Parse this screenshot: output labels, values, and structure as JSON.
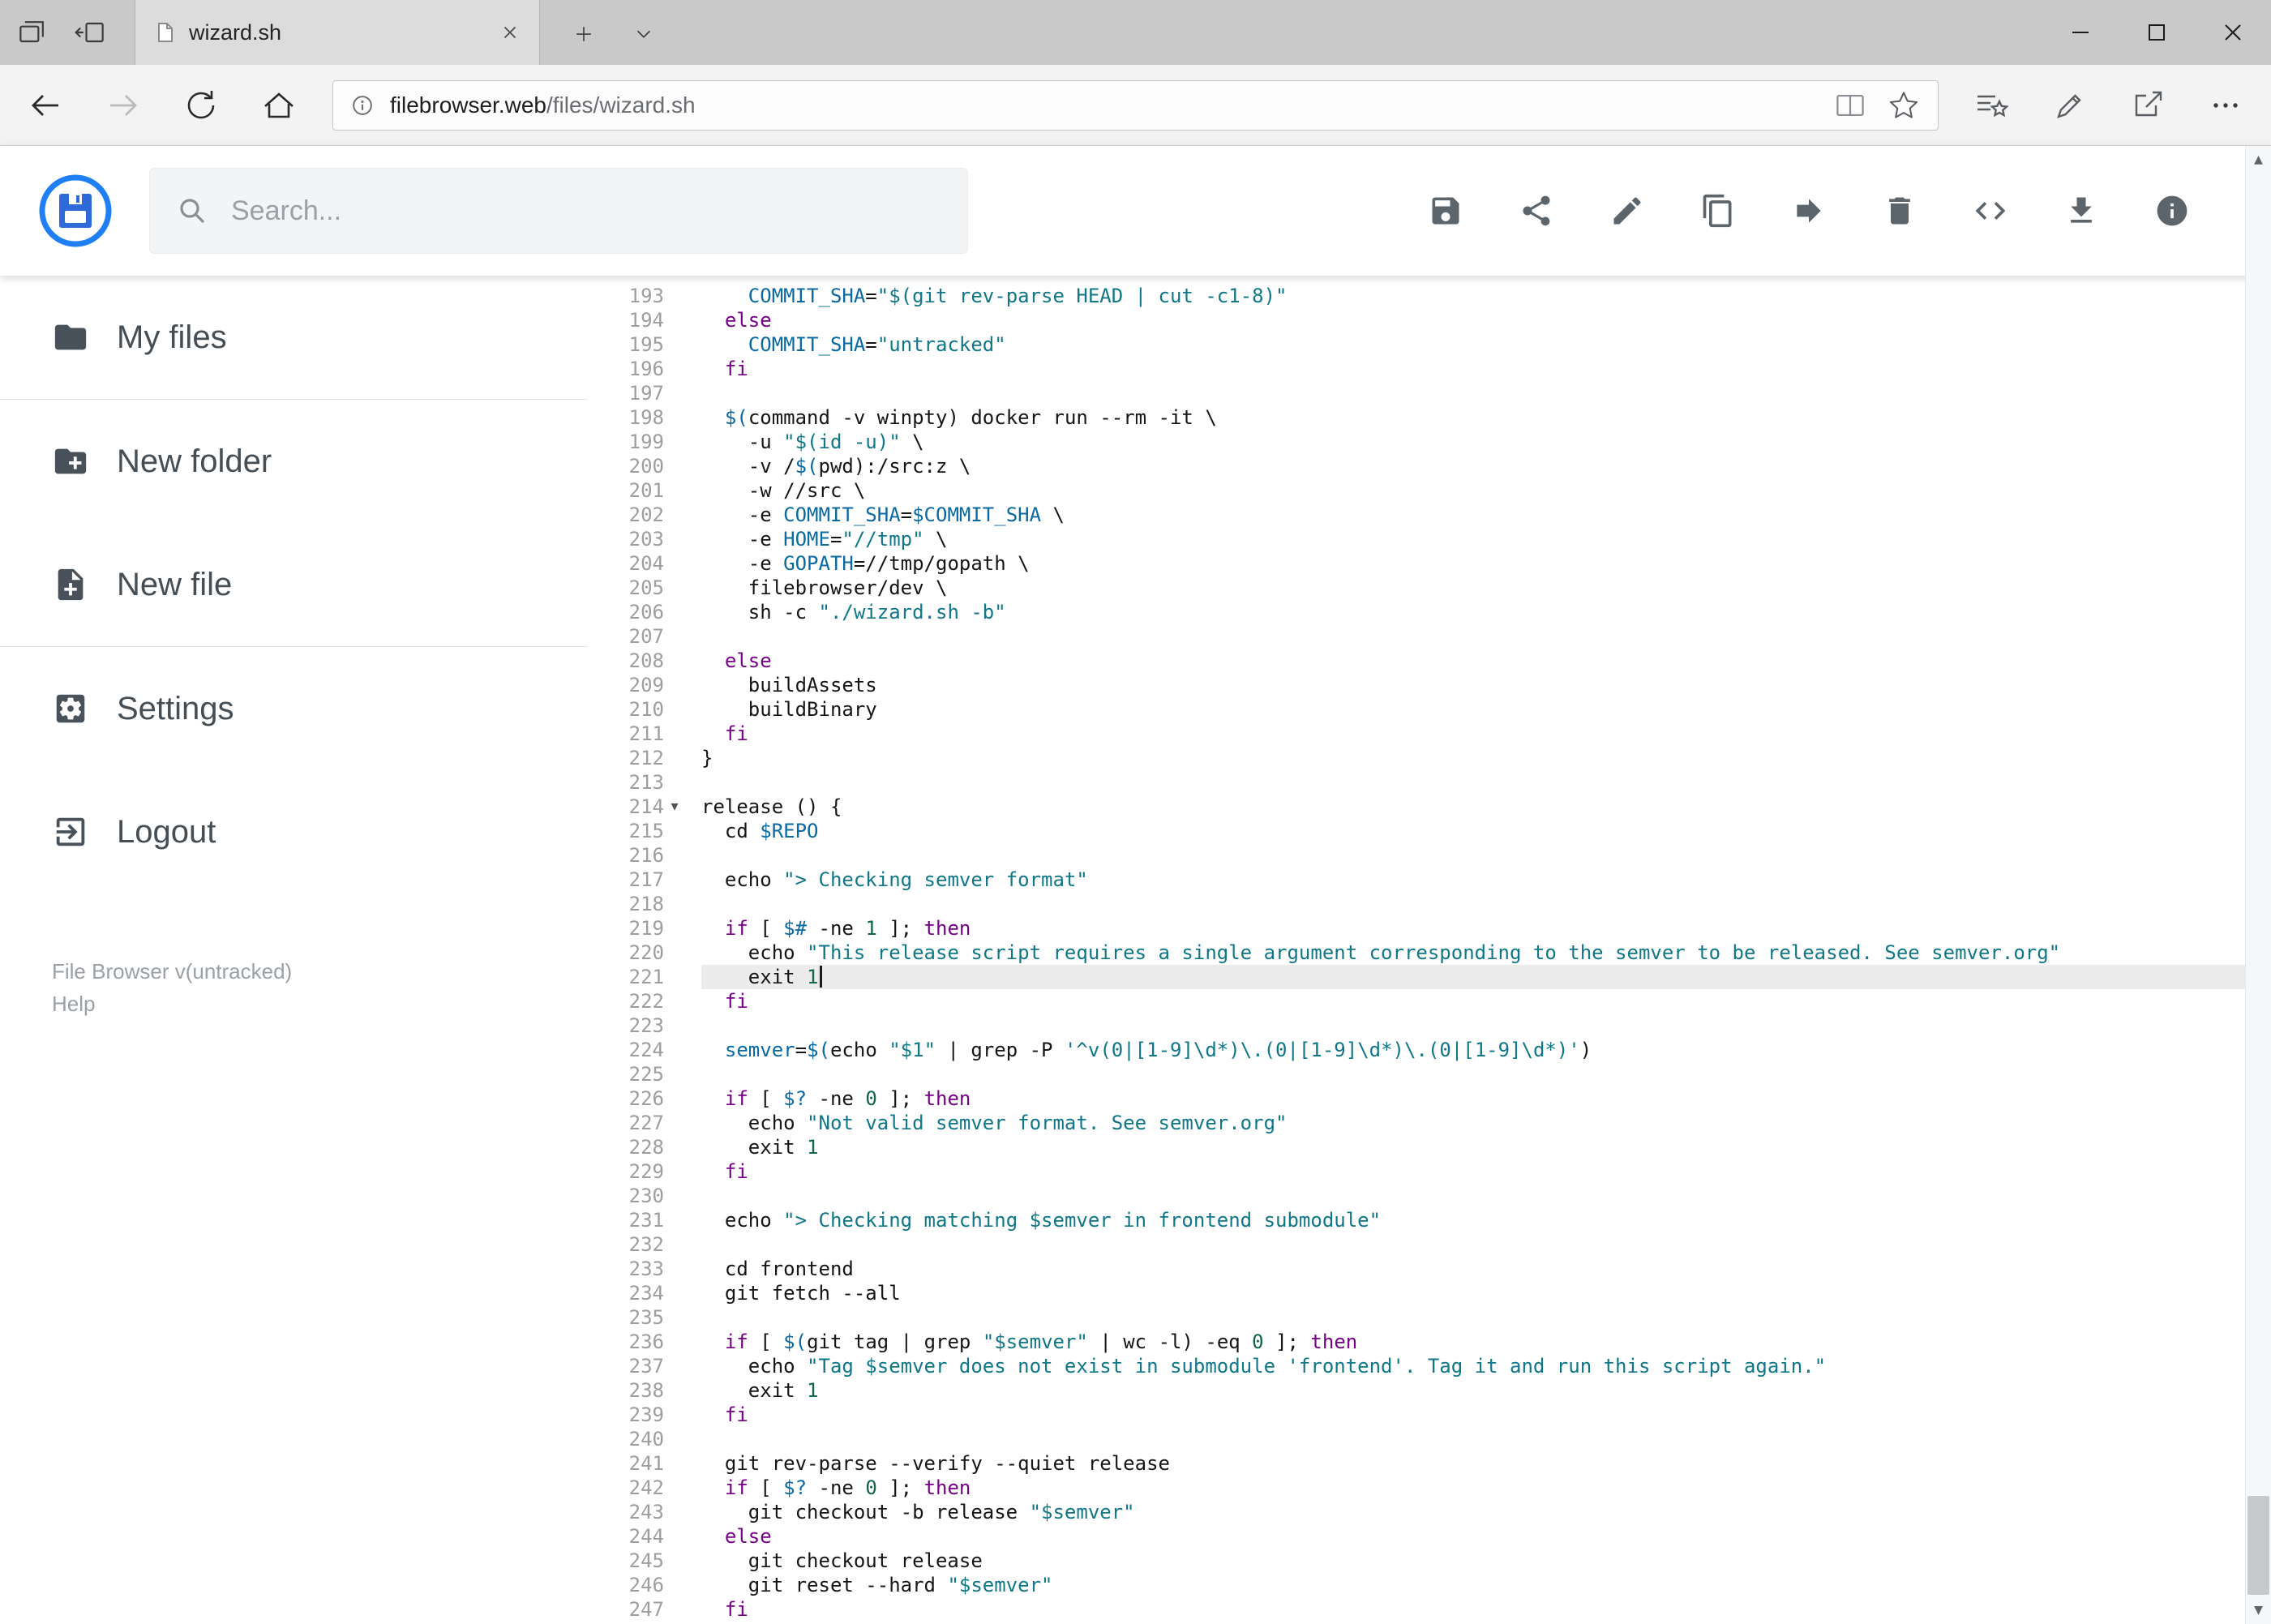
{
  "colors": {
    "accent_blue": "#1f7ff5",
    "keyword": "#770088",
    "string": "#0f7787",
    "variable": "#0969a2",
    "number": "#116644",
    "active_line_bg": "#ececec"
  },
  "browser": {
    "tab_title": "wizard.sh",
    "url_domain": "filebrowser.web",
    "url_path": "/files/wizard.sh"
  },
  "app": {
    "search_placeholder": "Search...",
    "toolbar_icons": [
      "save",
      "share",
      "edit",
      "copy",
      "move",
      "delete",
      "code",
      "download",
      "info"
    ]
  },
  "sidebar": {
    "items": [
      {
        "label": "My files",
        "icon": "folder-icon"
      },
      {
        "label": "New folder",
        "icon": "new-folder-icon"
      },
      {
        "label": "New file",
        "icon": "new-file-icon"
      },
      {
        "label": "Settings",
        "icon": "settings-icon"
      },
      {
        "label": "Logout",
        "icon": "logout-icon"
      }
    ],
    "footer": {
      "version": "File Browser v(untracked)",
      "help": "Help"
    }
  },
  "icons": {
    "fold_arrow": "▾",
    "scroll_up": "▲",
    "scroll_down": "▼"
  },
  "editor": {
    "first_line_number": 193,
    "active_line": 221,
    "cursor_line": 221,
    "fold_marker_line": 214,
    "lines": [
      "    COMMIT_SHA=\"$(git rev-parse HEAD | cut -c1-8)\"",
      "  else",
      "    COMMIT_SHA=\"untracked\"",
      "  fi",
      "",
      "  $(command -v winpty) docker run --rm -it \\",
      "    -u \"$(id -u)\" \\",
      "    -v /$(pwd):/src:z \\",
      "    -w //src \\",
      "    -e COMMIT_SHA=$COMMIT_SHA \\",
      "    -e HOME=\"//tmp\" \\",
      "    -e GOPATH=//tmp/gopath \\",
      "    filebrowser/dev \\",
      "    sh -c \"./wizard.sh -b\"",
      "",
      "  else",
      "    buildAssets",
      "    buildBinary",
      "  fi",
      "}",
      "",
      "release () {",
      "  cd $REPO",
      "",
      "  echo \"> Checking semver format\"",
      "",
      "  if [ $# -ne 1 ]; then",
      "    echo \"This release script requires a single argument corresponding to the semver to be released. See semver.org\"",
      "    exit 1",
      "  fi",
      "",
      "  semver=$(echo \"$1\" | grep -P '^v(0|[1-9]\\d*)\\.(0|[1-9]\\d*)\\.(0|[1-9]\\d*)')",
      "",
      "  if [ $? -ne 0 ]; then",
      "    echo \"Not valid semver format. See semver.org\"",
      "    exit 1",
      "  fi",
      "",
      "  echo \"> Checking matching $semver in frontend submodule\"",
      "",
      "  cd frontend",
      "  git fetch --all",
      "",
      "  if [ $(git tag | grep \"$semver\" | wc -l) -eq 0 ]; then",
      "    echo \"Tag $semver does not exist in submodule 'frontend'. Tag it and run this script again.\"",
      "    exit 1",
      "  fi",
      "",
      "  git rev-parse --verify --quiet release",
      "  if [ $? -ne 0 ]; then",
      "    git checkout -b release \"$semver\"",
      "  else",
      "    git checkout release",
      "    git reset --hard \"$semver\"",
      "  fi"
    ]
  }
}
